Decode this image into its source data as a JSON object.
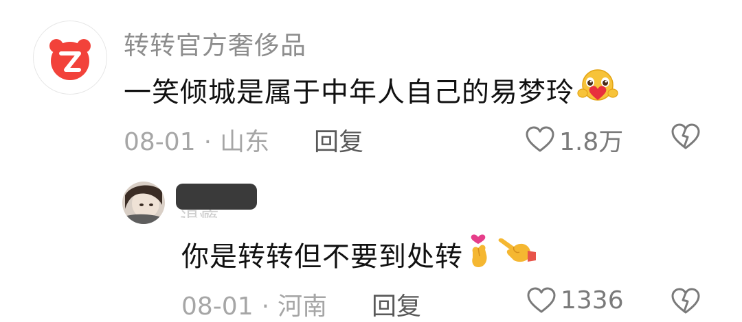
{
  "comment": {
    "username": "转转官方奢侈品",
    "text": "一笑倾城是属于中年人自己的易梦玲",
    "emoji": "smiling-face-with-hearts-emoji",
    "date": "08-01",
    "separator": "·",
    "location": "山东",
    "reply_label": "回复",
    "like_count": "1.8万",
    "avatar_icon": "zhuanzhuan-logo-icon",
    "accent_color": "#f2423a"
  },
  "reply": {
    "username_hint": "退瘾",
    "text": "你是转转但不要到处转",
    "emojis": [
      "hand-with-index-finger-and-thumb-crossed-emoji",
      "backhand-index-pointing-left-emoji"
    ],
    "date": "08-01",
    "separator": "·",
    "location": "河南",
    "reply_label": "回复",
    "like_count": "1336"
  }
}
